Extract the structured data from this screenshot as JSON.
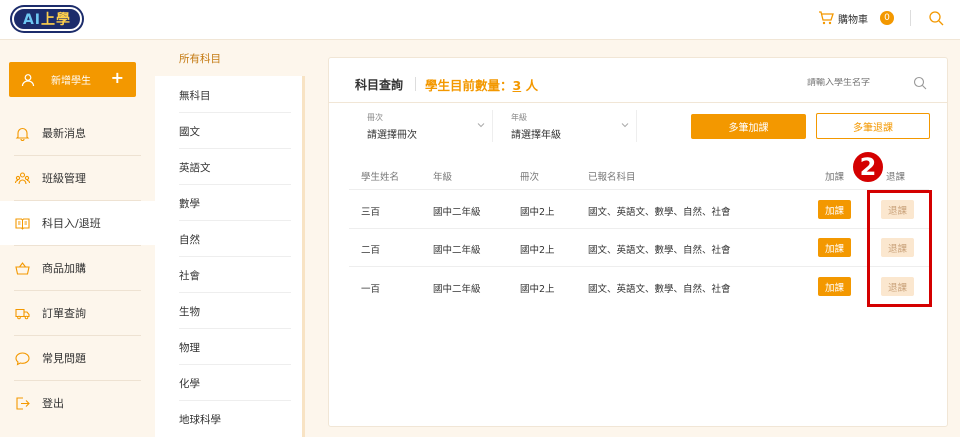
{
  "header": {
    "logo": "AI上學",
    "cart_label": "購物車",
    "cart_count": "0"
  },
  "sidebar": {
    "add_student": "新增學生",
    "items": [
      {
        "label": "最新消息"
      },
      {
        "label": "班級管理"
      },
      {
        "label": "科目入/退班"
      },
      {
        "label": "商品加購"
      },
      {
        "label": "訂單查詢"
      },
      {
        "label": "常見問題"
      },
      {
        "label": "登出"
      }
    ]
  },
  "subjects": [
    "所有科目",
    "無科目",
    "國文",
    "英語文",
    "數學",
    "自然",
    "社會",
    "生物",
    "物理",
    "化學",
    "地球科學"
  ],
  "panel": {
    "title": "科目查詢",
    "count_prefix": "學生目前數量：",
    "count_value": "3",
    "count_suffix": " 人",
    "search_placeholder": "請輸入學生名字",
    "filters": [
      {
        "label": "冊次",
        "value": "請選擇冊次"
      },
      {
        "label": "年級",
        "value": "請選擇年級"
      }
    ],
    "bulk_add": "多筆加課",
    "bulk_drop": "多筆退課"
  },
  "table": {
    "headers": [
      "學生姓名",
      "年級",
      "冊次",
      "已報名科目",
      "加課",
      "退課"
    ],
    "rows": [
      {
        "name": "三百",
        "grade": "國中二年級",
        "volume": "國中2上",
        "subjects": "國文、英語文、數學、自然、社會",
        "add": "加課",
        "drop": "退課"
      },
      {
        "name": "二百",
        "grade": "國中二年級",
        "volume": "國中2上",
        "subjects": "國文、英語文、數學、自然、社會",
        "add": "加課",
        "drop": "退課"
      },
      {
        "name": "一百",
        "grade": "國中二年級",
        "volume": "國中2上",
        "subjects": "國文、英語文、數學、自然、社會",
        "add": "加課",
        "drop": "退課"
      }
    ]
  },
  "annotation": {
    "step": "2",
    "color": "#d40000"
  },
  "colors": {
    "accent": "#f39800",
    "background": "#fdf6ec"
  }
}
